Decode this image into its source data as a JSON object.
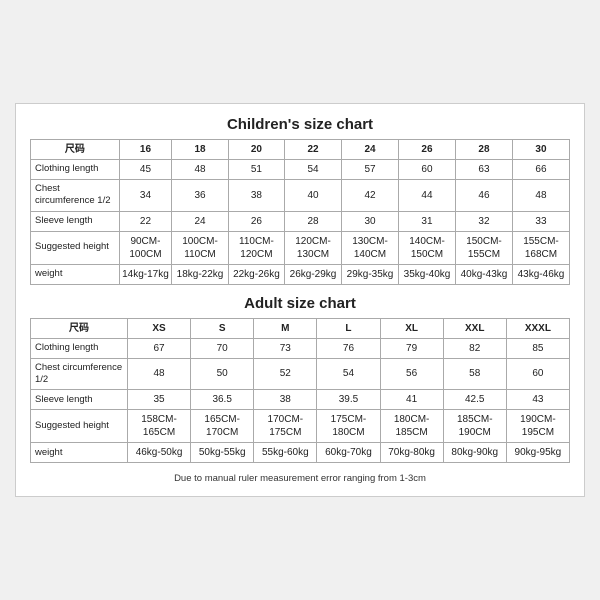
{
  "children_chart": {
    "title": "Children's size chart",
    "columns": [
      "尺码",
      "16",
      "18",
      "20",
      "22",
      "24",
      "26",
      "28",
      "30"
    ],
    "rows": [
      {
        "label": "Clothing length",
        "values": [
          "45",
          "48",
          "51",
          "54",
          "57",
          "60",
          "63",
          "66"
        ]
      },
      {
        "label": "Chest circumference 1/2",
        "values": [
          "34",
          "36",
          "38",
          "40",
          "42",
          "44",
          "46",
          "48"
        ]
      },
      {
        "label": "Sleeve length",
        "values": [
          "22",
          "24",
          "26",
          "28",
          "30",
          "31",
          "32",
          "33"
        ]
      },
      {
        "label": "Suggested height",
        "values": [
          "90CM-100CM",
          "100CM-110CM",
          "110CM-120CM",
          "120CM-130CM",
          "130CM-140CM",
          "140CM-150CM",
          "150CM-155CM",
          "155CM-168CM"
        ]
      },
      {
        "label": "weight",
        "values": [
          "14kg-17kg",
          "18kg-22kg",
          "22kg-26kg",
          "26kg-29kg",
          "29kg-35kg",
          "35kg-40kg",
          "40kg-43kg",
          "43kg-46kg"
        ]
      }
    ]
  },
  "adult_chart": {
    "title": "Adult size chart",
    "columns": [
      "尺码",
      "XS",
      "S",
      "M",
      "L",
      "XL",
      "XXL",
      "XXXL"
    ],
    "rows": [
      {
        "label": "Clothing length",
        "values": [
          "67",
          "70",
          "73",
          "76",
          "79",
          "82",
          "85"
        ]
      },
      {
        "label": "Chest circumference 1/2",
        "values": [
          "48",
          "50",
          "52",
          "54",
          "56",
          "58",
          "60"
        ]
      },
      {
        "label": "Sleeve length",
        "values": [
          "35",
          "36.5",
          "38",
          "39.5",
          "41",
          "42.5",
          "43"
        ]
      },
      {
        "label": "Suggested height",
        "values": [
          "158CM-165CM",
          "165CM-170CM",
          "170CM-175CM",
          "175CM-180CM",
          "180CM-185CM",
          "185CM-190CM",
          "190CM-195CM"
        ]
      },
      {
        "label": "weight",
        "values": [
          "46kg-50kg",
          "50kg-55kg",
          "55kg-60kg",
          "60kg-70kg",
          "70kg-80kg",
          "80kg-90kg",
          "90kg-95kg"
        ]
      }
    ]
  },
  "note": "Due to manual ruler measurement error ranging from 1-3cm"
}
